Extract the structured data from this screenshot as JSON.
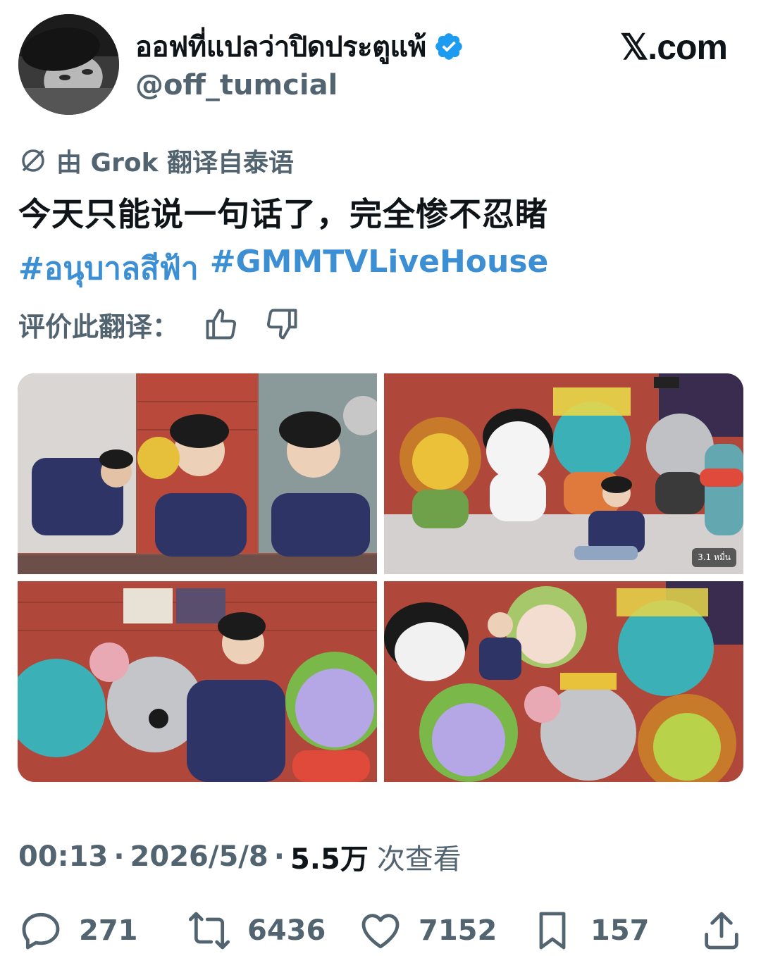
{
  "author": {
    "display_name": "ออฟที่แปลว่าปิดประตูแพ้",
    "handle": "@off_tumcial",
    "verified": true
  },
  "site_label": "𝕏.com",
  "translation_notice": "由 Grok 翻译自泰语",
  "tweet_text": "今天只能说一句话了，完全惨不忍睹",
  "hashtags": [
    "#อนุบาลสีฟ้า",
    "#GMMTVLiveHouse"
  ],
  "rate_translation_label": "评价此翻译：",
  "media": {
    "count": 4,
    "views_badge": "3.1 หมื่น"
  },
  "meta": {
    "time": "00:13",
    "separator": "·",
    "date": "2026/5/8",
    "views_count": "5.5万",
    "views_label": "次查看"
  },
  "actions": {
    "replies": "271",
    "reposts": "6436",
    "likes": "7152",
    "bookmarks": "157"
  },
  "colors": {
    "hashtag": "#3d8fd4",
    "verified": "#1d9bf0",
    "secondary_text": "#536471",
    "primary_text": "#0f1419"
  }
}
